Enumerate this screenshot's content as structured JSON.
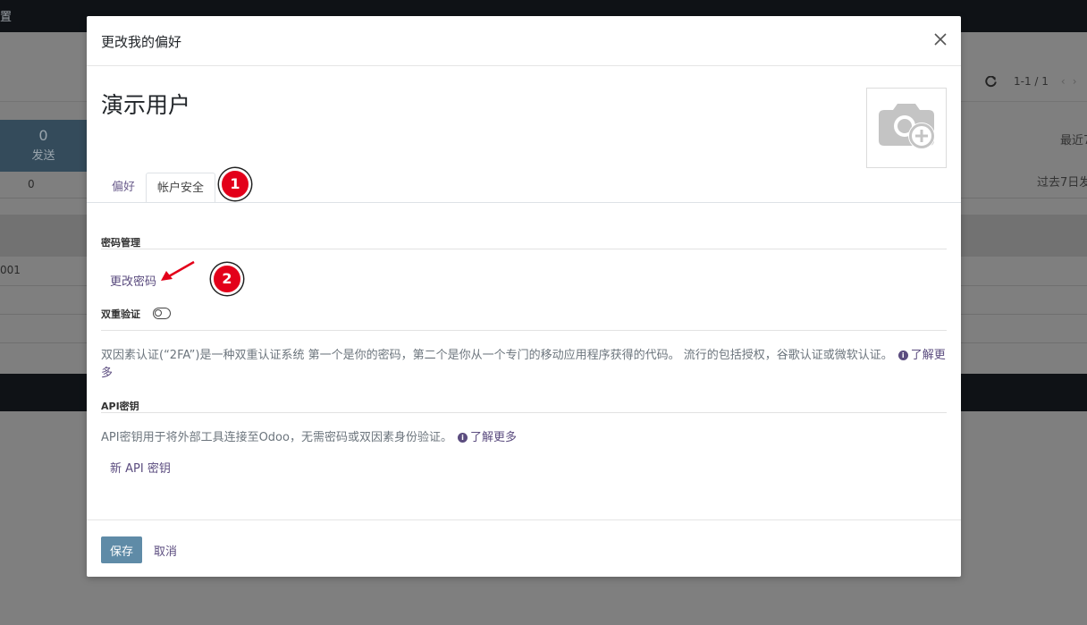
{
  "background": {
    "topbar_text": "置",
    "pager": "1-1 / 1",
    "stat_value": "0",
    "stat_label": "发送",
    "stat_row_value": "0",
    "right_top_text": "最近7",
    "right_mid_text": "过去7日发",
    "row_text": "001"
  },
  "modal": {
    "title": "更改我的偏好",
    "user_name": "演示用户",
    "tabs": [
      {
        "label": "偏好"
      },
      {
        "label": "帐户安全"
      }
    ],
    "badges": [
      "1",
      "2"
    ],
    "password_section": {
      "title": "密码管理",
      "change_password_link": "更改密码"
    },
    "two_factor": {
      "label": "双重验证",
      "description": "双因素认证(“2FA”)是一种双重认证系统 第一个是你的密码，第二个是你从一个专门的移动应用程序获得的代码。 流行的包括授权，谷歌认证或微软认证。",
      "learn_more": "了解更多"
    },
    "api_keys": {
      "title": "API密钥",
      "description": "API密钥用于将外部工具连接至Odoo，无需密码或双因素身份验证。",
      "learn_more": "了解更多",
      "new_key_link": "新 API 密钥"
    },
    "footer": {
      "save_label": "保存",
      "cancel_label": "取消"
    }
  },
  "colors": {
    "annotation_badge": "#e3001a",
    "primary_button": "#5f8ba7",
    "link": "#5b4c7f"
  },
  "icons": [
    "close-icon",
    "camera-plus-icon",
    "info-icon",
    "toggle-icon",
    "arrow-annotation-icon",
    "refresh-icon"
  ]
}
